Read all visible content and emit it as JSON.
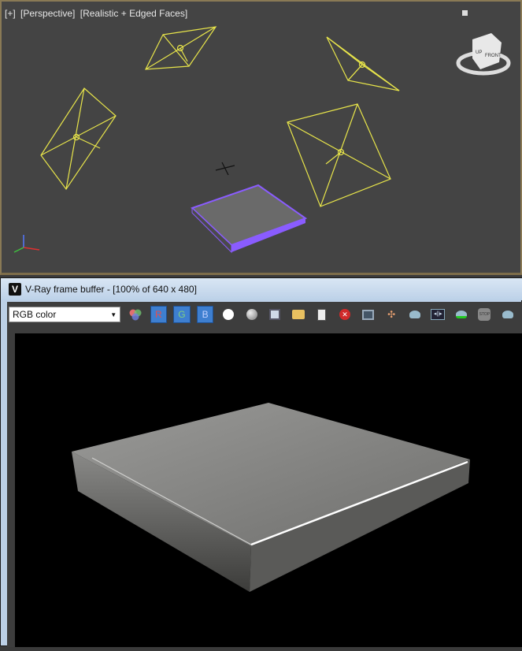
{
  "viewport": {
    "label_parts": [
      "[+]",
      "[Perspective]",
      "[Realistic + Edged Faces]"
    ],
    "viewcube_labels": [
      "UP",
      "FRONT"
    ],
    "axis_labels": [
      "x",
      "y",
      "z"
    ]
  },
  "frame_buffer": {
    "title": "V-Ray frame buffer - [100% of 640 x 480]",
    "channel_select": "RGB color",
    "channel_buttons": [
      "R",
      "G",
      "B"
    ],
    "icons": [
      "color-correction-icon",
      "white-circle-icon",
      "gray-circle-icon",
      "save-icon",
      "open-folder-icon",
      "clipboard-icon",
      "clear-icon",
      "region-render-icon",
      "track-mouse-icon",
      "render-teapot-icon",
      "lens-effects-icon",
      "render-last-icon",
      "stop-icon",
      "teapot-icon"
    ]
  },
  "colors": {
    "light_wire": "#e8e54a",
    "selected_object": "#8a5cff",
    "viewport_bg": "#444444"
  }
}
